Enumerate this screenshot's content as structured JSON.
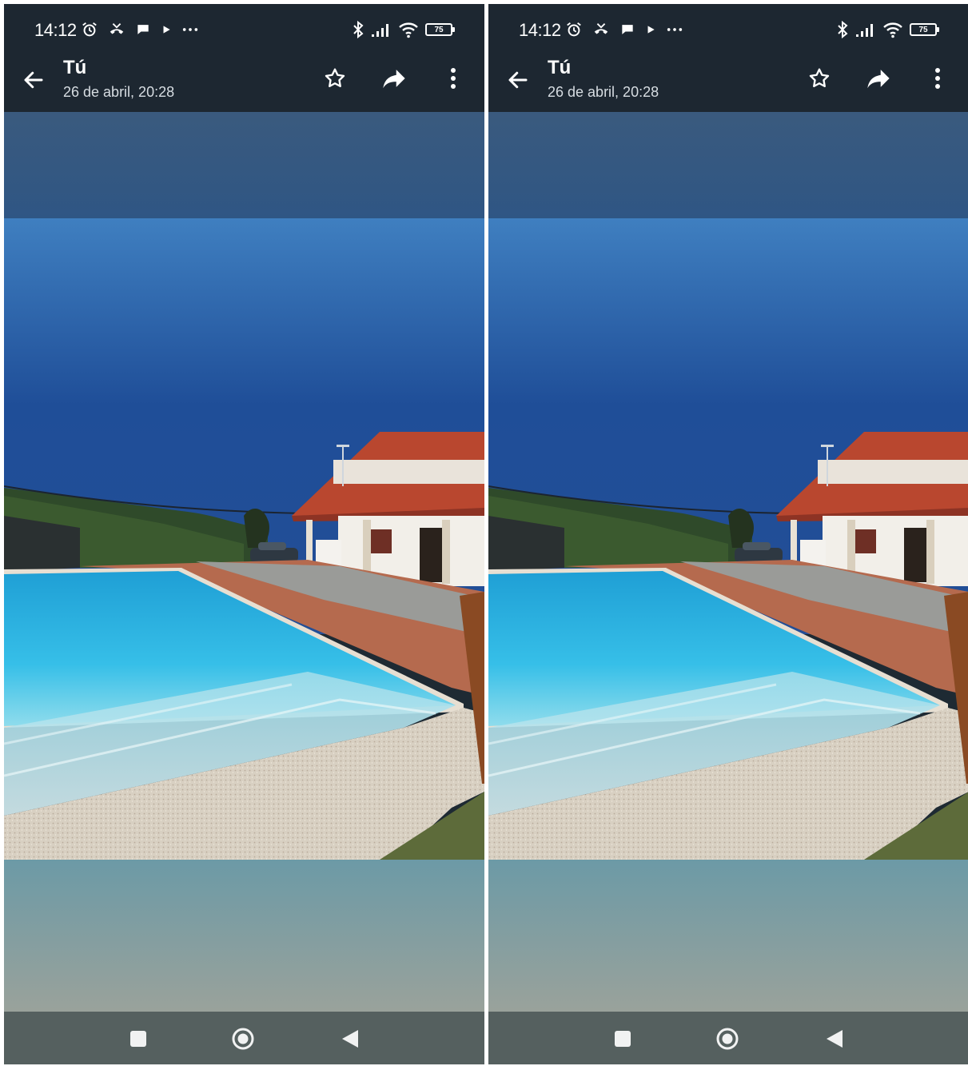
{
  "screens": [
    {
      "status": {
        "time": "14:12",
        "battery": "75"
      },
      "appbar": {
        "title": "Tú",
        "subtitle": "26 de abril, 20:28"
      }
    },
    {
      "status": {
        "time": "14:12",
        "battery": "75"
      },
      "appbar": {
        "title": "Tú",
        "subtitle": "26 de abril, 20:28"
      }
    }
  ],
  "icons": {
    "status_left": [
      "alarm-icon",
      "missed-call-icon",
      "chat-bubble-icon",
      "play-icon",
      "more-notifications-icon"
    ],
    "status_right": [
      "bluetooth-icon",
      "signal-icon",
      "wifi-icon",
      "battery-icon"
    ],
    "appbar": [
      "back-arrow-icon",
      "star-icon",
      "share-icon",
      "more-options-icon"
    ],
    "nav": [
      "recent-apps-icon",
      "home-icon",
      "back-icon"
    ]
  },
  "colors": {
    "appbar": "#1d2731",
    "sky_top": "#3e7dbf",
    "sky_bottom": "#1a3f88",
    "pool": "#2fb7e4",
    "roof": "#b9472f",
    "navbar": "#55605f"
  }
}
